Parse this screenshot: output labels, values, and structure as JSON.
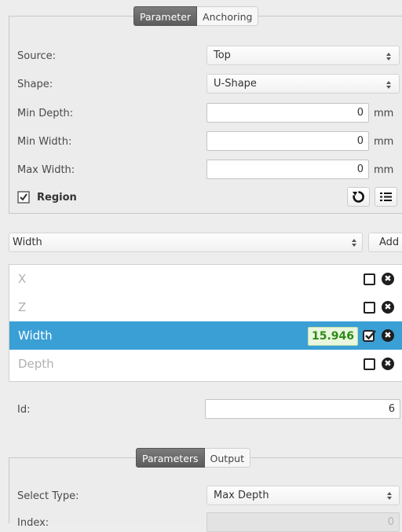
{
  "parameter_panel": {
    "tabs": [
      {
        "label": "Parameter",
        "active": true
      },
      {
        "label": "Anchoring",
        "active": false
      }
    ],
    "source": {
      "label": "Source:",
      "value": "Top"
    },
    "shape": {
      "label": "Shape:",
      "value": "U-Shape"
    },
    "min_depth": {
      "label": "Min Depth:",
      "value": "0",
      "unit": "mm"
    },
    "min_width": {
      "label": "Min Width:",
      "value": "0",
      "unit": "mm"
    },
    "max_width": {
      "label": "Max Width:",
      "value": "0",
      "unit": "mm"
    },
    "region": {
      "label": "Region",
      "checked": true
    }
  },
  "measurement_select": {
    "value": "Width",
    "add_label": "Add"
  },
  "measurements": [
    {
      "label": "X",
      "selected": false,
      "checked": false
    },
    {
      "label": "Z",
      "selected": false,
      "checked": false
    },
    {
      "label": "Width",
      "selected": true,
      "checked": true,
      "value": "15.946"
    },
    {
      "label": "Depth",
      "selected": false,
      "checked": false
    }
  ],
  "id_field": {
    "label": "Id:",
    "value": "6"
  },
  "bottom_panel": {
    "tabs": [
      {
        "label": "Parameters",
        "active": true
      },
      {
        "label": "Output",
        "active": false
      }
    ],
    "select_type": {
      "label": "Select Type:",
      "value": "Max Depth"
    },
    "index": {
      "label": "Index:",
      "value": "0"
    }
  },
  "colors": {
    "selected_row": "#3a9fd5",
    "value_badge_text": "#2e8a1a",
    "active_tab": "#666666"
  }
}
